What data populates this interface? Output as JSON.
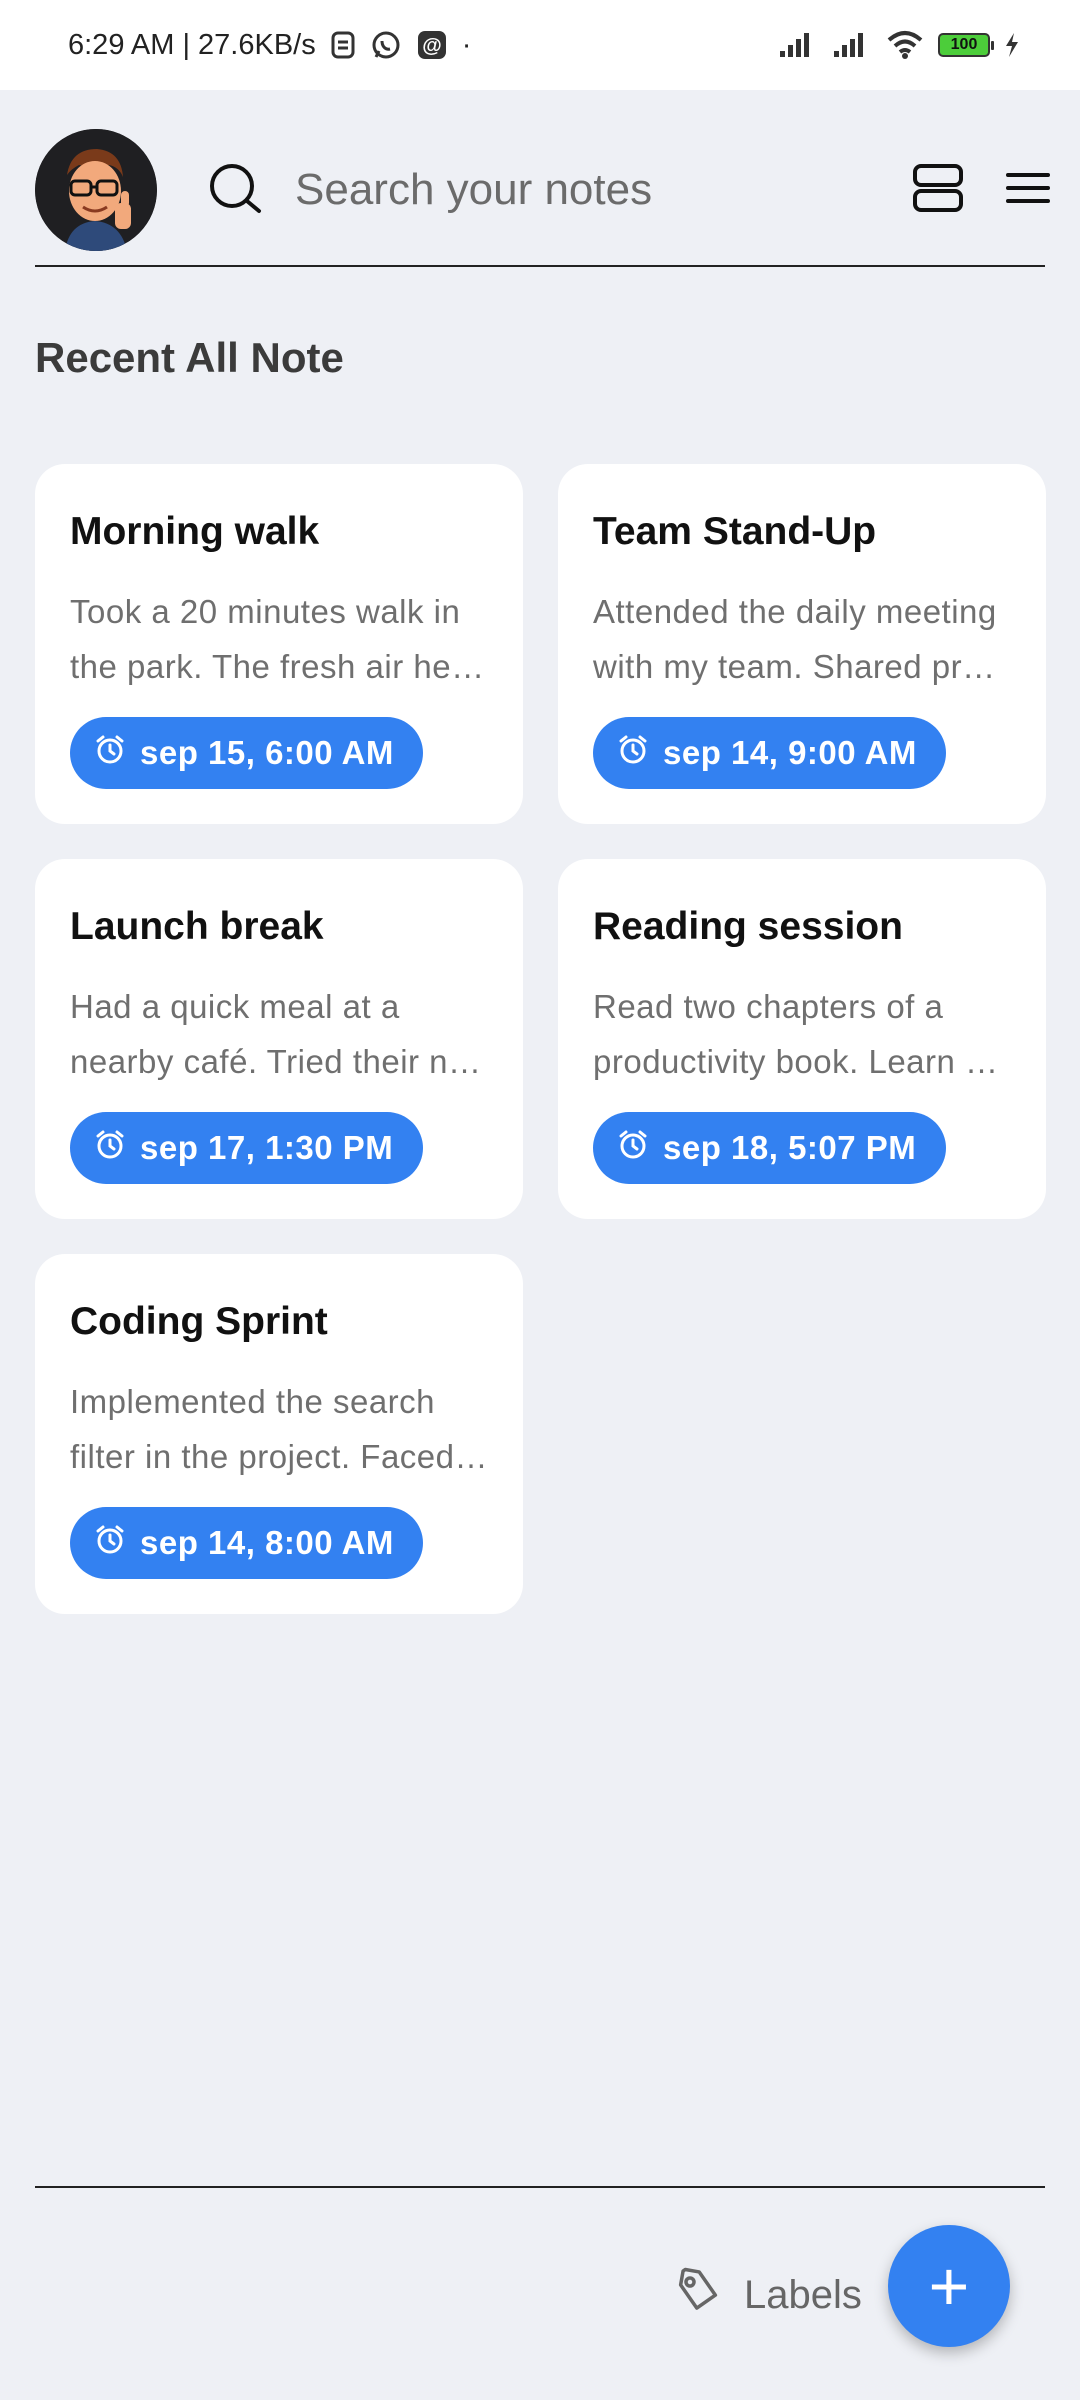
{
  "status_bar": {
    "time_speed": "6:29 AM | 27.6KB/s",
    "dot": "·",
    "battery": "100"
  },
  "header": {
    "search_placeholder": "Search your notes"
  },
  "section_title": "Recent All Note",
  "notes": [
    {
      "title": "Morning walk",
      "line1": "Took a 20 minutes walk in",
      "line2": "the park. The fresh air hel…",
      "time": "sep 15, 6:00 AM"
    },
    {
      "title": "Team Stand-Up",
      "line1": "Attended the daily meeting",
      "line2": "with my team. Shared pro…",
      "time": "sep 14, 9:00 AM"
    },
    {
      "title": "Launch break",
      "line1": "Had a quick meal at a",
      "line2": "nearby café. Tried their n…",
      "time": "sep 17, 1:30 PM"
    },
    {
      "title": "Reading session",
      "line1": "Read two chapters of a",
      "line2": "productivity book. Learn …",
      "time": "sep 18, 5:07 PM"
    },
    {
      "title": "Coding Sprint",
      "line1": "Implemented the search",
      "line2": "filter in the project. Faced…",
      "time": "sep 14, 8:00 AM"
    }
  ],
  "bottom_bar": {
    "labels": "Labels",
    "fab": "+"
  },
  "colors": {
    "accent": "#3381f1",
    "background": "#eef0f5",
    "card": "#ffffff"
  }
}
